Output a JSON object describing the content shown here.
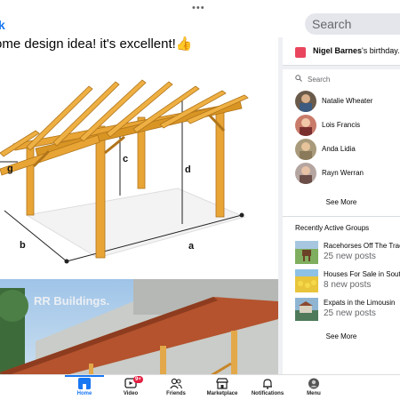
{
  "header": {
    "dots": "•••",
    "back_label": "k",
    "search_placeholder": "Search"
  },
  "post": {
    "text": "ome design idea! it's excellent!👍"
  },
  "diagram": {
    "labels": [
      "g",
      "c",
      "d",
      "b",
      "a"
    ]
  },
  "photo": {
    "watermark": "RR Buildings."
  },
  "birthday": {
    "name": "Nigel Barnes",
    "suffix": "'s birthday."
  },
  "contacts": {
    "search_label": "Search",
    "items": [
      {
        "name": "Natalie Wheater"
      },
      {
        "name": "Lois Francis"
      },
      {
        "name": "Anda Lidia"
      },
      {
        "name": "Rayn Werran"
      }
    ],
    "see_more": "See More"
  },
  "groups": {
    "title": "Recently Active Groups",
    "items": [
      {
        "name": "Racehorses Off The Track",
        "sub": "25 new posts"
      },
      {
        "name": "Houses For Sale in South",
        "sub": "8 new posts"
      },
      {
        "name": "Expats in the Limousin",
        "sub": "25 new posts"
      }
    ],
    "see_more": "See More"
  },
  "nav": {
    "items": [
      {
        "label": "Home"
      },
      {
        "label": "Video",
        "badge": "9+"
      },
      {
        "label": "Friends"
      },
      {
        "label": "Marketplace"
      },
      {
        "label": "Notifications"
      },
      {
        "label": "Menu"
      }
    ]
  },
  "colors": {
    "accent": "#1877f2",
    "badge": "#e41e3f",
    "wood": "#e8a535"
  }
}
